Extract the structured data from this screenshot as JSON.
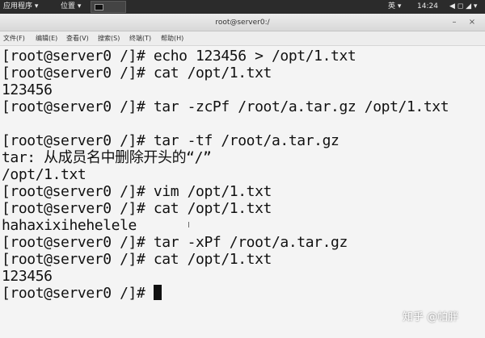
{
  "topbar": {
    "applications": "应用程序 ▾",
    "places": "位置 ▾",
    "ime": "英 ▾",
    "clock": "14:24",
    "system": "◀ ◻ ◢ ▾"
  },
  "window": {
    "title": "root@server0:/",
    "minimize_glyph": "–",
    "close_glyph": "×"
  },
  "menu": {
    "file": "文件(F)",
    "edit": "编辑(E)",
    "view": "查看(V)",
    "search": "搜索(S)",
    "terminal": "终端(T)",
    "help": "帮助(H)"
  },
  "terminal": {
    "lines": [
      "[root@server0 /]# echo 123456 > /opt/1.txt",
      "[root@server0 /]# cat /opt/1.txt",
      "123456",
      "[root@server0 /]# tar -zcPf /root/a.tar.gz /opt/1.txt",
      "",
      "[root@server0 /]# tar -tf /root/a.tar.gz",
      "tar: 从成员名中删除开头的“/”",
      "/opt/1.txt",
      "[root@server0 /]# vim /opt/1.txt",
      "[root@server0 /]# cat /opt/1.txt",
      "hahaxixihehelele",
      "[root@server0 /]# tar -xPf /root/a.tar.gz",
      "[root@server0 /]# cat /opt/1.txt",
      "123456"
    ],
    "prompt": "[root@server0 /]# "
  },
  "watermark": "知乎 @帕胖"
}
